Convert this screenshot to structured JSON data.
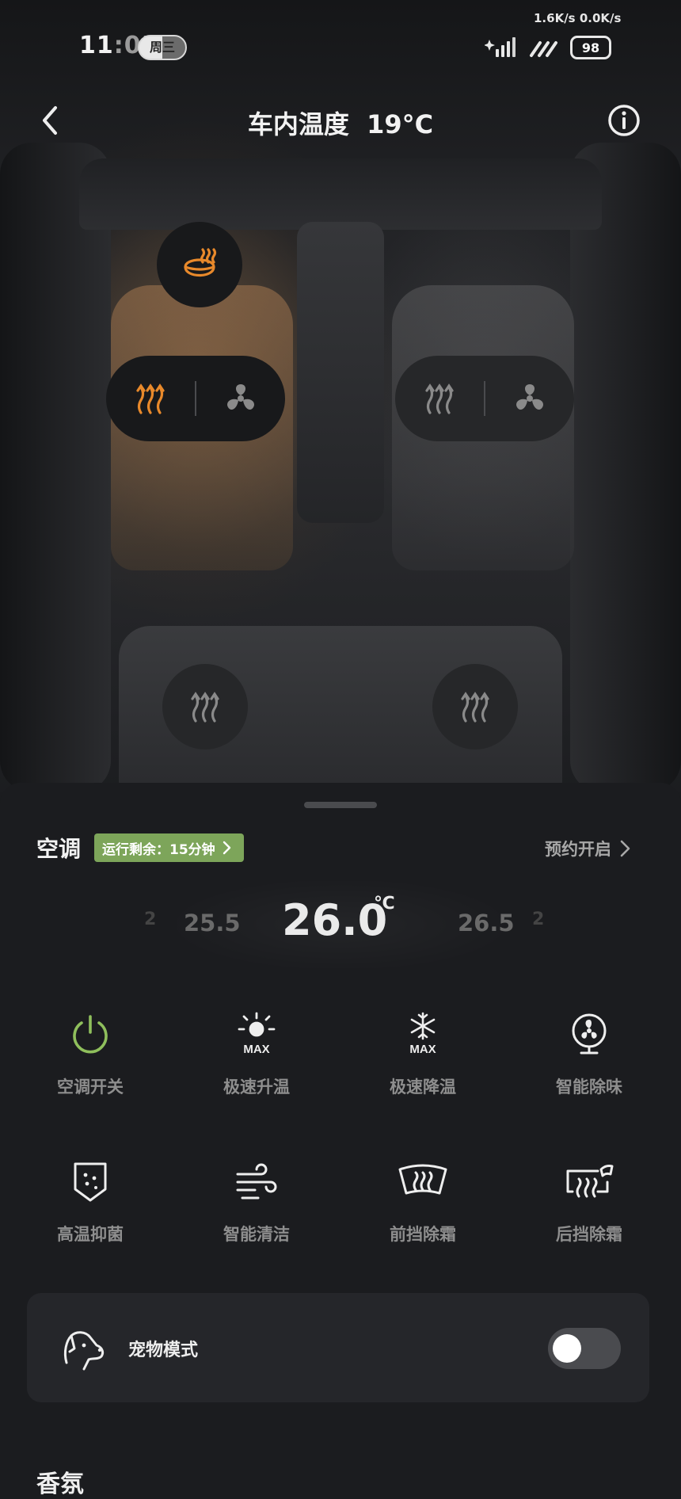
{
  "status_bar": {
    "time_hour": "11",
    "time_min": ":05",
    "weekday": "周三",
    "net_speed": "1.6K/s 0.0K/s",
    "battery": "98"
  },
  "header": {
    "title": "车内温度",
    "cabin_temp": "19°C"
  },
  "seats": {
    "front_left_heating_active": true,
    "colors": {
      "active": "#e8892b",
      "inactive": "#8a8a8a"
    }
  },
  "ac": {
    "title": "空调",
    "runtime_badge": "运行剩余：15分钟",
    "schedule_link": "预约开启",
    "temperature": {
      "prev_far": "2",
      "prev": "25.5",
      "current": "26.0",
      "unit": "℃",
      "next": "26.5",
      "next_far": "2"
    }
  },
  "functions": [
    {
      "label": "空调开关",
      "icon": "power-icon"
    },
    {
      "label": "极速升温",
      "icon": "sun-max-icon"
    },
    {
      "label": "极速降温",
      "icon": "snowflake-max-icon"
    },
    {
      "label": "智能除味",
      "icon": "fan-icon"
    },
    {
      "label": "高温抑菌",
      "icon": "shield-dots-icon"
    },
    {
      "label": "智能清洁",
      "icon": "wind-icon"
    },
    {
      "label": "前挡除霜",
      "icon": "front-defrost-icon"
    },
    {
      "label": "后挡除霜",
      "icon": "rear-defrost-icon"
    }
  ],
  "pet_mode": {
    "label": "宠物模式",
    "enabled": false
  },
  "next_section": {
    "title": "香氛"
  },
  "colors": {
    "accent_green": "#7da55a",
    "power_green": "#8fbf5c",
    "heat_orange": "#e8892b"
  }
}
